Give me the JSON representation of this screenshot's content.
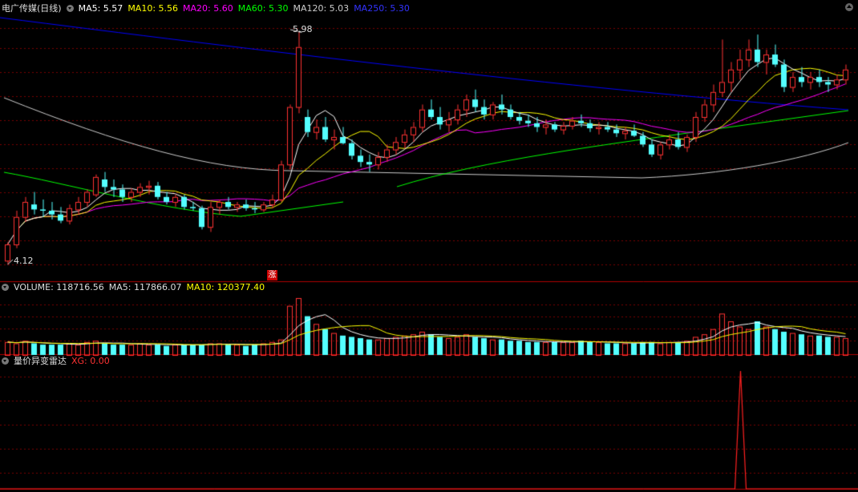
{
  "header": {
    "title": "电广传媒(日线)",
    "ma5": "MA5: 5.57",
    "ma10": "MA10: 5.56",
    "ma20": "MA20: 5.60",
    "ma60": "MA60: 5.30",
    "ma120": "MA120: 5.03",
    "ma250": "MA250: 5.30"
  },
  "volume_header": {
    "volume": "VOLUME: 118716.56",
    "ma5": "MA5: 117866.07",
    "ma10": "MA10: 120377.40"
  },
  "indicator_header": {
    "name": "量价异变雷达",
    "xg": "XG: 0.00"
  },
  "annotations": {
    "high": "5.98",
    "low": "4.12",
    "zhang": "涨"
  },
  "colors": {
    "up": "#ff3232",
    "down": "#54ffff",
    "ma5": "#ffffff",
    "ma10": "#ffff00",
    "ma20": "#ff00ff",
    "ma60": "#00ff00",
    "ma120": "#cccccc",
    "ma250": "#0000ff",
    "grid": "#7a0000"
  },
  "chart_data": {
    "type": "candlestick",
    "price_range": [
      4.12,
      5.98
    ],
    "candles": [
      [
        4.15,
        4.3,
        4.12,
        4.28
      ],
      [
        4.28,
        4.55,
        4.25,
        4.5
      ],
      [
        4.5,
        4.66,
        4.46,
        4.62
      ],
      [
        4.6,
        4.7,
        4.52,
        4.56
      ],
      [
        4.56,
        4.64,
        4.5,
        4.55
      ],
      [
        4.55,
        4.62,
        4.48,
        4.52
      ],
      [
        4.52,
        4.58,
        4.45,
        4.47
      ],
      [
        4.47,
        4.6,
        4.44,
        4.57
      ],
      [
        4.56,
        4.66,
        4.52,
        4.62
      ],
      [
        4.62,
        4.72,
        4.58,
        4.7
      ],
      [
        4.68,
        4.84,
        4.66,
        4.82
      ],
      [
        4.8,
        4.86,
        4.7,
        4.74
      ],
      [
        4.74,
        4.8,
        4.66,
        4.72
      ],
      [
        4.72,
        4.76,
        4.62,
        4.66
      ],
      [
        4.66,
        4.73,
        4.62,
        4.7
      ],
      [
        4.7,
        4.77,
        4.66,
        4.74
      ],
      [
        4.74,
        4.79,
        4.68,
        4.75
      ],
      [
        4.75,
        4.78,
        4.64,
        4.66
      ],
      [
        4.66,
        4.7,
        4.6,
        4.62
      ],
      [
        4.62,
        4.68,
        4.58,
        4.66
      ],
      [
        4.66,
        4.68,
        4.56,
        4.58
      ],
      [
        4.58,
        4.62,
        4.55,
        4.57
      ],
      [
        4.57,
        4.59,
        4.4,
        4.42
      ],
      [
        4.42,
        4.62,
        4.38,
        4.58
      ],
      [
        4.58,
        4.64,
        4.52,
        4.62
      ],
      [
        4.62,
        4.66,
        4.56,
        4.58
      ],
      [
        4.58,
        4.62,
        4.54,
        4.6
      ],
      [
        4.6,
        4.64,
        4.55,
        4.57
      ],
      [
        4.57,
        4.62,
        4.53,
        4.56
      ],
      [
        4.56,
        4.62,
        4.54,
        4.6
      ],
      [
        4.6,
        4.68,
        4.57,
        4.64
      ],
      [
        4.64,
        4.95,
        4.62,
        4.92
      ],
      [
        4.92,
        5.4,
        4.88,
        5.38
      ],
      [
        5.38,
        5.98,
        5.33,
        5.86
      ],
      [
        5.3,
        5.36,
        5.14,
        5.18
      ],
      [
        5.18,
        5.28,
        5.12,
        5.22
      ],
      [
        5.22,
        5.3,
        5.1,
        5.12
      ],
      [
        5.12,
        5.2,
        5.04,
        5.14
      ],
      [
        5.14,
        5.22,
        5.08,
        5.09
      ],
      [
        5.09,
        5.12,
        4.96,
        4.99
      ],
      [
        4.99,
        5.04,
        4.9,
        4.94
      ],
      [
        4.94,
        5.0,
        4.86,
        4.92
      ],
      [
        4.92,
        5.02,
        4.88,
        4.98
      ],
      [
        4.98,
        5.08,
        4.94,
        5.04
      ],
      [
        5.04,
        5.14,
        5.0,
        5.1
      ],
      [
        5.1,
        5.2,
        5.05,
        5.16
      ],
      [
        5.16,
        5.26,
        5.1,
        5.22
      ],
      [
        5.22,
        5.4,
        5.18,
        5.36
      ],
      [
        5.36,
        5.44,
        5.28,
        5.3
      ],
      [
        5.3,
        5.38,
        5.2,
        5.24
      ],
      [
        5.24,
        5.34,
        5.18,
        5.28
      ],
      [
        5.28,
        5.4,
        5.24,
        5.36
      ],
      [
        5.36,
        5.48,
        5.3,
        5.44
      ],
      [
        5.44,
        5.52,
        5.34,
        5.38
      ],
      [
        5.38,
        5.44,
        5.28,
        5.32
      ],
      [
        5.32,
        5.42,
        5.28,
        5.4
      ],
      [
        5.4,
        5.48,
        5.32,
        5.36
      ],
      [
        5.36,
        5.4,
        5.28,
        5.3
      ],
      [
        5.3,
        5.34,
        5.24,
        5.27
      ],
      [
        5.27,
        5.32,
        5.22,
        5.25
      ],
      [
        5.25,
        5.3,
        5.18,
        5.22
      ],
      [
        5.22,
        5.28,
        5.16,
        5.24
      ],
      [
        5.24,
        5.26,
        5.18,
        5.2
      ],
      [
        5.2,
        5.26,
        5.16,
        5.23
      ],
      [
        5.23,
        5.3,
        5.2,
        5.27
      ],
      [
        5.27,
        5.32,
        5.22,
        5.25
      ],
      [
        5.25,
        5.28,
        5.18,
        5.21
      ],
      [
        5.21,
        5.26,
        5.16,
        5.22
      ],
      [
        5.22,
        5.26,
        5.18,
        5.2
      ],
      [
        5.2,
        5.24,
        5.14,
        5.17
      ],
      [
        5.17,
        5.22,
        5.12,
        5.19
      ],
      [
        5.19,
        5.24,
        5.14,
        5.15
      ],
      [
        5.15,
        5.18,
        5.06,
        5.08
      ],
      [
        5.08,
        5.12,
        4.98,
        5.0
      ],
      [
        5.0,
        5.1,
        4.96,
        5.08
      ],
      [
        5.08,
        5.16,
        5.04,
        5.12
      ],
      [
        5.12,
        5.18,
        5.04,
        5.06
      ],
      [
        5.06,
        5.16,
        5.02,
        5.14
      ],
      [
        5.14,
        5.34,
        5.1,
        5.3
      ],
      [
        5.3,
        5.44,
        5.26,
        5.4
      ],
      [
        5.4,
        5.56,
        5.34,
        5.5
      ],
      [
        5.5,
        5.92,
        5.46,
        5.58
      ],
      [
        5.58,
        5.74,
        5.5,
        5.68
      ],
      [
        5.68,
        5.84,
        5.6,
        5.76
      ],
      [
        5.76,
        5.92,
        5.7,
        5.84
      ],
      [
        5.84,
        5.96,
        5.7,
        5.74
      ],
      [
        5.74,
        5.84,
        5.64,
        5.8
      ],
      [
        5.8,
        5.88,
        5.7,
        5.72
      ],
      [
        5.72,
        5.76,
        5.5,
        5.54
      ],
      [
        5.54,
        5.66,
        5.5,
        5.62
      ],
      [
        5.62,
        5.7,
        5.54,
        5.58
      ],
      [
        5.58,
        5.66,
        5.52,
        5.62
      ],
      [
        5.62,
        5.68,
        5.54,
        5.58
      ],
      [
        5.58,
        5.62,
        5.5,
        5.56
      ],
      [
        5.56,
        5.64,
        5.52,
        5.6
      ],
      [
        5.6,
        5.72,
        5.56,
        5.68
      ]
    ],
    "volume": [
      10,
      9,
      11,
      9,
      8,
      8,
      8,
      9,
      8,
      10,
      11,
      9,
      8,
      8,
      8,
      9,
      8,
      8,
      7,
      8,
      8,
      8,
      8,
      9,
      9,
      8,
      8,
      7,
      8,
      9,
      10,
      12,
      38,
      44,
      30,
      24,
      20,
      17,
      15,
      14,
      13,
      12,
      12,
      13,
      14,
      15,
      16,
      18,
      16,
      14,
      13,
      14,
      16,
      14,
      13,
      12,
      12,
      11,
      11,
      10,
      10,
      10,
      10,
      10,
      10,
      11,
      10,
      10,
      9,
      9,
      9,
      9,
      10,
      10,
      9,
      10,
      10,
      11,
      14,
      16,
      20,
      32,
      26,
      22,
      20,
      26,
      22,
      20,
      18,
      17,
      16,
      15,
      15,
      14,
      14,
      13
    ],
    "xg_signal_index": 82
  }
}
